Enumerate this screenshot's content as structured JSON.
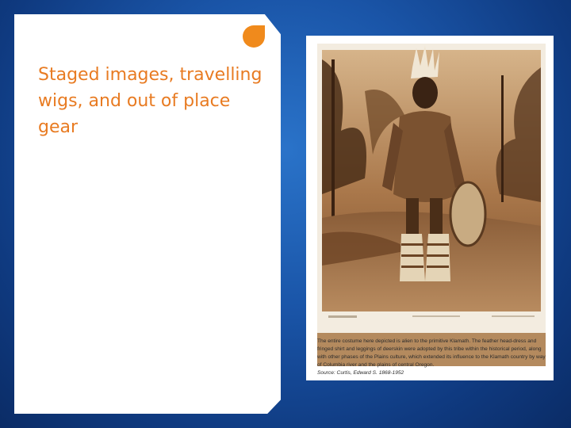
{
  "slide": {
    "title": "Staged images, travelling wigs, and out of place gear"
  },
  "figure": {
    "caption": "The entire costume here depicted is alien to the primitive Klamath. The feather head-dress and fringed shirt and leggings of deerskin were adopted by this tribe within the historical period, along with other phases of the Plains culture, which extended its influence to the Klamath country by way of Columbia river and the plains of central Oregon.",
    "source": "Source: Curtis, Edward S. 1868-1952"
  },
  "colors": {
    "accent": "#f08a1c",
    "title": "#e87b22",
    "background": "#1a55a8"
  },
  "icons": {
    "accent": "orange-leaf-shape"
  }
}
